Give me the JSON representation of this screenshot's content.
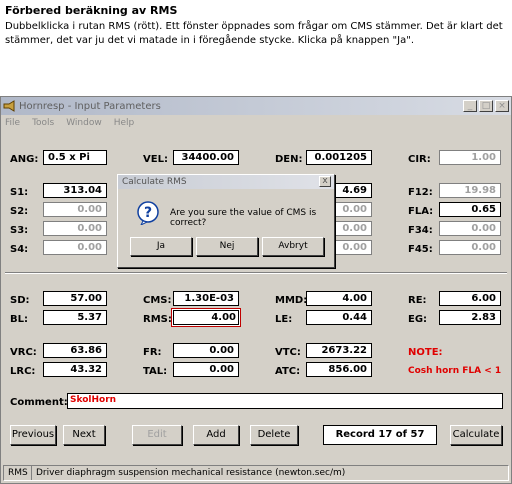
{
  "doc": {
    "heading": "Förbered beräkning av RMS",
    "paragraph": "Dubbelklicka i rutan RMS (rött). Ett fönster öppnades som frågar om CMS stämmer. Det är klart det stämmer, det var ju det vi matade in i föregående stycke. Klicka på knappen \"Ja\"."
  },
  "window": {
    "title": "Hornresp - Input Parameters",
    "menu": [
      "File",
      "Tools",
      "Window",
      "Help"
    ]
  },
  "params": {
    "ang": {
      "label": "ANG:",
      "value": "0.5 x Pi"
    },
    "vel": {
      "label": "VEL:",
      "value": "34400.00"
    },
    "den": {
      "label": "DEN:",
      "value": "0.001205"
    },
    "cir": {
      "label": "CIR:",
      "value": "1.00"
    },
    "s1": {
      "label": "S1:",
      "value": "313.04"
    },
    "s2": {
      "label": "S2:",
      "value": "0.00"
    },
    "s3": {
      "label": "S3:",
      "value": "0.00"
    },
    "s4": {
      "label": "S4:",
      "value": "0.00"
    },
    "l12_partial": "4.69",
    "l23_partial": "0.00",
    "l34_partial": "0.00",
    "l45_partial": "0.00",
    "f12": {
      "label": "F12:",
      "value": "19.98"
    },
    "fla": {
      "label": "FLA:",
      "value": "0.65"
    },
    "f34": {
      "label": "F34:",
      "value": "0.00"
    },
    "f45": {
      "label": "F45:",
      "value": "0.00"
    },
    "sd": {
      "label": "SD:",
      "value": "57.00"
    },
    "bl": {
      "label": "BL:",
      "value": "5.37"
    },
    "cms": {
      "label": "CMS:",
      "value": "1.30E-03"
    },
    "rms": {
      "label": "RMS:",
      "value": "4.00"
    },
    "mmd": {
      "label": "MMD:",
      "value": "4.00"
    },
    "le": {
      "label": "LE:",
      "value": "0.44"
    },
    "re": {
      "label": "RE:",
      "value": "6.00"
    },
    "eg": {
      "label": "EG:",
      "value": "2.83"
    },
    "vrc": {
      "label": "VRC:",
      "value": "63.86"
    },
    "lrc": {
      "label": "LRC:",
      "value": "43.32"
    },
    "fr": {
      "label": "FR:",
      "value": "0.00"
    },
    "tal": {
      "label": "TAL:",
      "value": "0.00"
    },
    "vtc": {
      "label": "VTC:",
      "value": "2673.22"
    },
    "atc": {
      "label": "ATC:",
      "value": "856.00"
    }
  },
  "note": {
    "label": "NOTE:",
    "text": "Cosh horn  FLA < 1"
  },
  "comment": {
    "label": "Comment:",
    "value": "SkolHorn"
  },
  "buttons": {
    "previous": "Previous",
    "next": "Next",
    "edit": "Edit",
    "add": "Add",
    "delete": "Delete",
    "record": "Record 17 of 57",
    "calculate": "Calculate"
  },
  "status": {
    "key": "RMS",
    "text": "Driver diaphragm suspension mechanical resistance  (newton.sec/m)"
  },
  "dialog": {
    "title": "Calculate RMS",
    "close": "x",
    "message": "Are you sure the value of CMS is correct?",
    "yes": "Ja",
    "no": "Nej",
    "cancel": "Avbryt"
  },
  "colors": {
    "accent": "#e00000",
    "face": "#d4d0c8"
  }
}
